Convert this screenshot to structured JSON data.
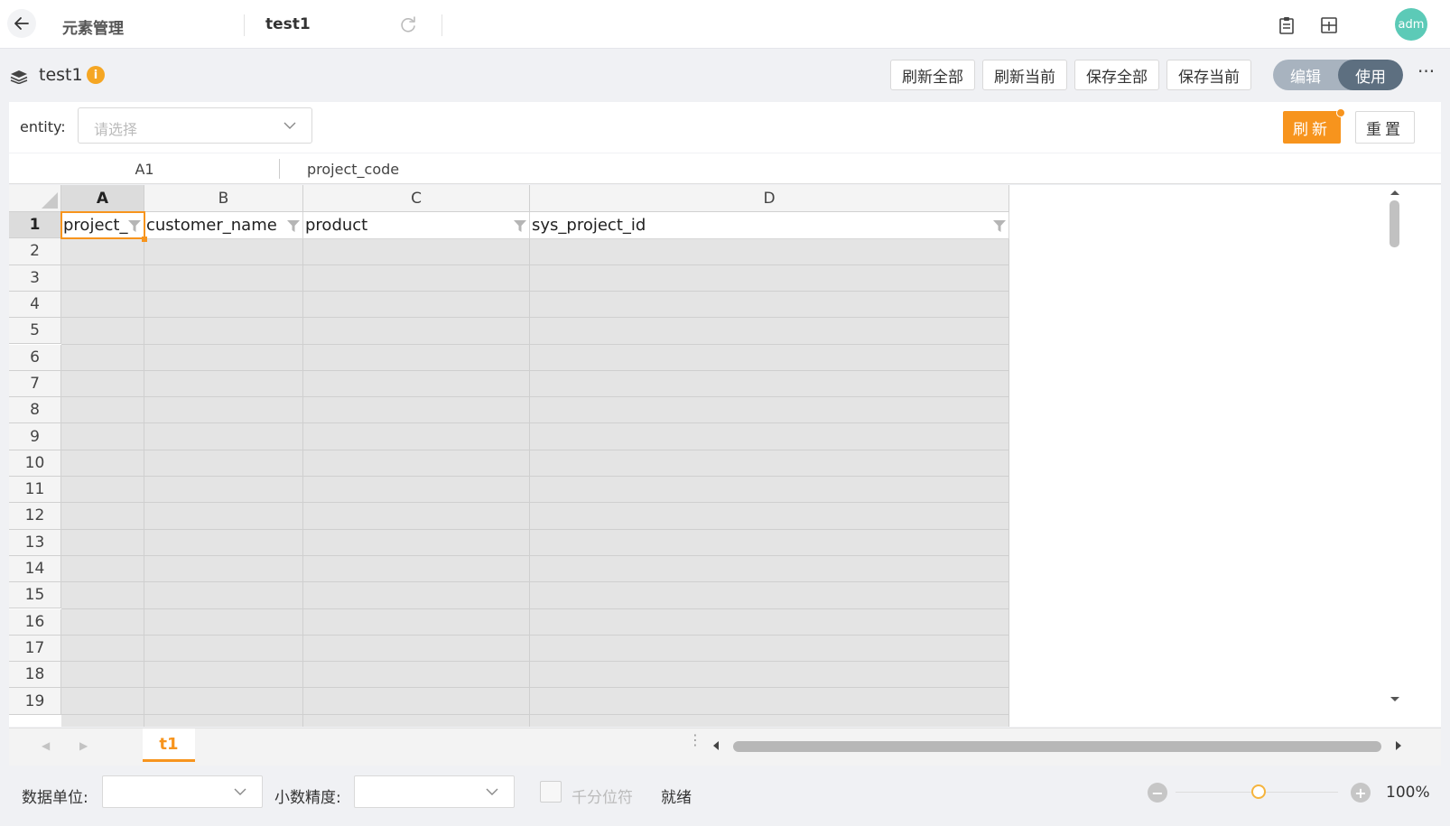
{
  "topbar": {
    "title": "元素管理",
    "tab_label": "test1",
    "avatar": "adm",
    "icons": [
      "back-arrow-icon",
      "refresh-icon",
      "clipboard-icon",
      "layout-icon"
    ]
  },
  "header": {
    "title": "test1",
    "info_symbol": "i",
    "buttons": [
      "刷新全部",
      "刷新当前",
      "保存全部",
      "保存当前"
    ],
    "toggle": {
      "left": "编辑",
      "right": "使用",
      "active": "使用"
    },
    "more": "···"
  },
  "filter": {
    "entity_label": "entity:",
    "entity_placeholder": "请选择",
    "refresh_label": "刷新",
    "reset_label": "重置"
  },
  "formula_bar": {
    "cell_ref": "A1",
    "content": "project_code"
  },
  "sheet": {
    "columns": [
      "A",
      "B",
      "C",
      "D"
    ],
    "active_column": "A",
    "rows": [
      "1",
      "2",
      "3",
      "4",
      "5",
      "6",
      "7",
      "8",
      "9",
      "10",
      "11",
      "12",
      "13",
      "14",
      "15",
      "16",
      "17",
      "18",
      "19"
    ],
    "active_row": "1",
    "header_cells": [
      "project_",
      "customer_name",
      "product",
      "sys_project_id"
    ],
    "selected_cell": "A1",
    "body_fill": "#e4e4e4",
    "accent": "#f7941d"
  },
  "tabs": {
    "sheet_tab": "t1",
    "dots": "⋮"
  },
  "statusbar": {
    "data_unit_label": "数据单位:",
    "decimal_label": "小数精度:",
    "thousands_label": "千分位符",
    "status": "就绪",
    "zoom_minus": "−",
    "zoom_plus": "+",
    "zoom": "100%"
  }
}
